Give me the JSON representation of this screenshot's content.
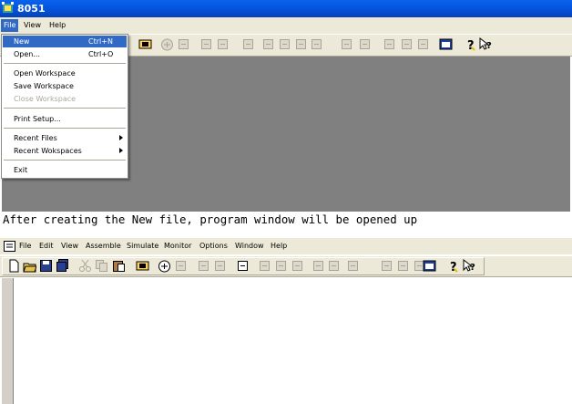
{
  "window1": {
    "title": "8051",
    "menu": [
      {
        "label": "File",
        "active": true
      },
      {
        "label": "View",
        "active": false
      },
      {
        "label": "Help",
        "active": false
      }
    ],
    "file_menu": {
      "items": [
        {
          "label": "New",
          "shortcut": "Ctrl+N",
          "selected": true,
          "disabled": false
        },
        {
          "label": "Open...",
          "shortcut": "Ctrl+O",
          "selected": false,
          "disabled": false
        },
        {
          "label": "Open Workspace",
          "shortcut": "",
          "selected": false,
          "disabled": false
        },
        {
          "label": "Save Workspace",
          "shortcut": "",
          "selected": false,
          "disabled": false
        },
        {
          "label": "Close Workspace",
          "shortcut": "",
          "selected": false,
          "disabled": true
        },
        {
          "label": "Print Setup...",
          "shortcut": "",
          "selected": false,
          "disabled": false
        },
        {
          "label": "Recent Files",
          "shortcut": "",
          "submenu": true
        },
        {
          "label": "Recent Wokspaces",
          "shortcut": "",
          "submenu": true
        },
        {
          "label": "Exit",
          "shortcut": ""
        }
      ]
    },
    "workspace_color": "#808080"
  },
  "caption": "After creating the New file, program window will be opened up",
  "window2": {
    "menu": [
      "File",
      "Edit",
      "View",
      "Assemble",
      "Simulate",
      "Monitor",
      "Options",
      "Window",
      "Help"
    ]
  },
  "colors": {
    "titlebar": "#0451d8",
    "highlight": "#316ac5",
    "chrome": "#ece9d8",
    "workspace": "#808080"
  },
  "toolbar_icons": [
    "new-icon",
    "open-icon",
    "save-icon",
    "save-all-icon",
    "cut-icon",
    "copy-icon",
    "paste-icon",
    "build-icon",
    "simulate-icon",
    "step-icon",
    "breakpoint-icon",
    "run-icon",
    "watch-icon",
    "step-into-icon",
    "step-over-icon",
    "step-out-icon",
    "register-icon",
    "stop-icon",
    "memory-icon",
    "window-icon",
    "help-icon",
    "context-help-icon"
  ]
}
